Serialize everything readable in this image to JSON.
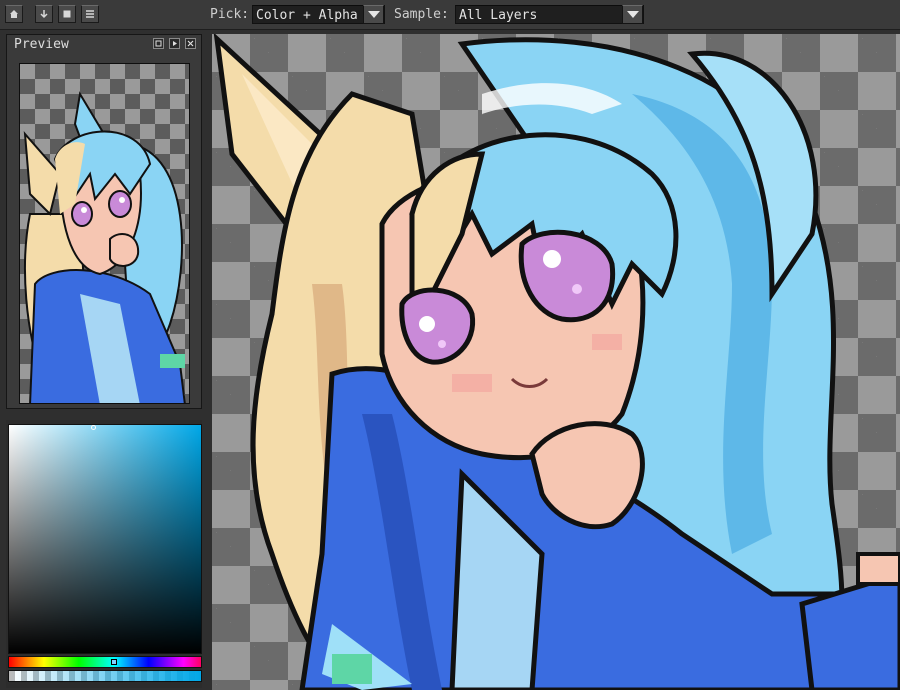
{
  "toolbar": {
    "home_icon": "home-icon",
    "download_icon": "down-arrow-icon",
    "stop_icon": "square-icon",
    "menu_icon": "menu-icon",
    "pick_label": "Pick:",
    "pick_value": "Color + Alpha",
    "sample_label": "Sample:",
    "sample_value": "All Layers"
  },
  "preview": {
    "title": "Preview",
    "buttons": [
      "fit-icon",
      "play-icon",
      "close-icon"
    ]
  },
  "colors": {
    "selected": "#00a8e8",
    "hair_blue": "#8ad4f4",
    "hair_blonde": "#f4dcaa",
    "jacket": "#3a6ce0",
    "skin": "#f4bca6",
    "eye": "#c060c0"
  }
}
